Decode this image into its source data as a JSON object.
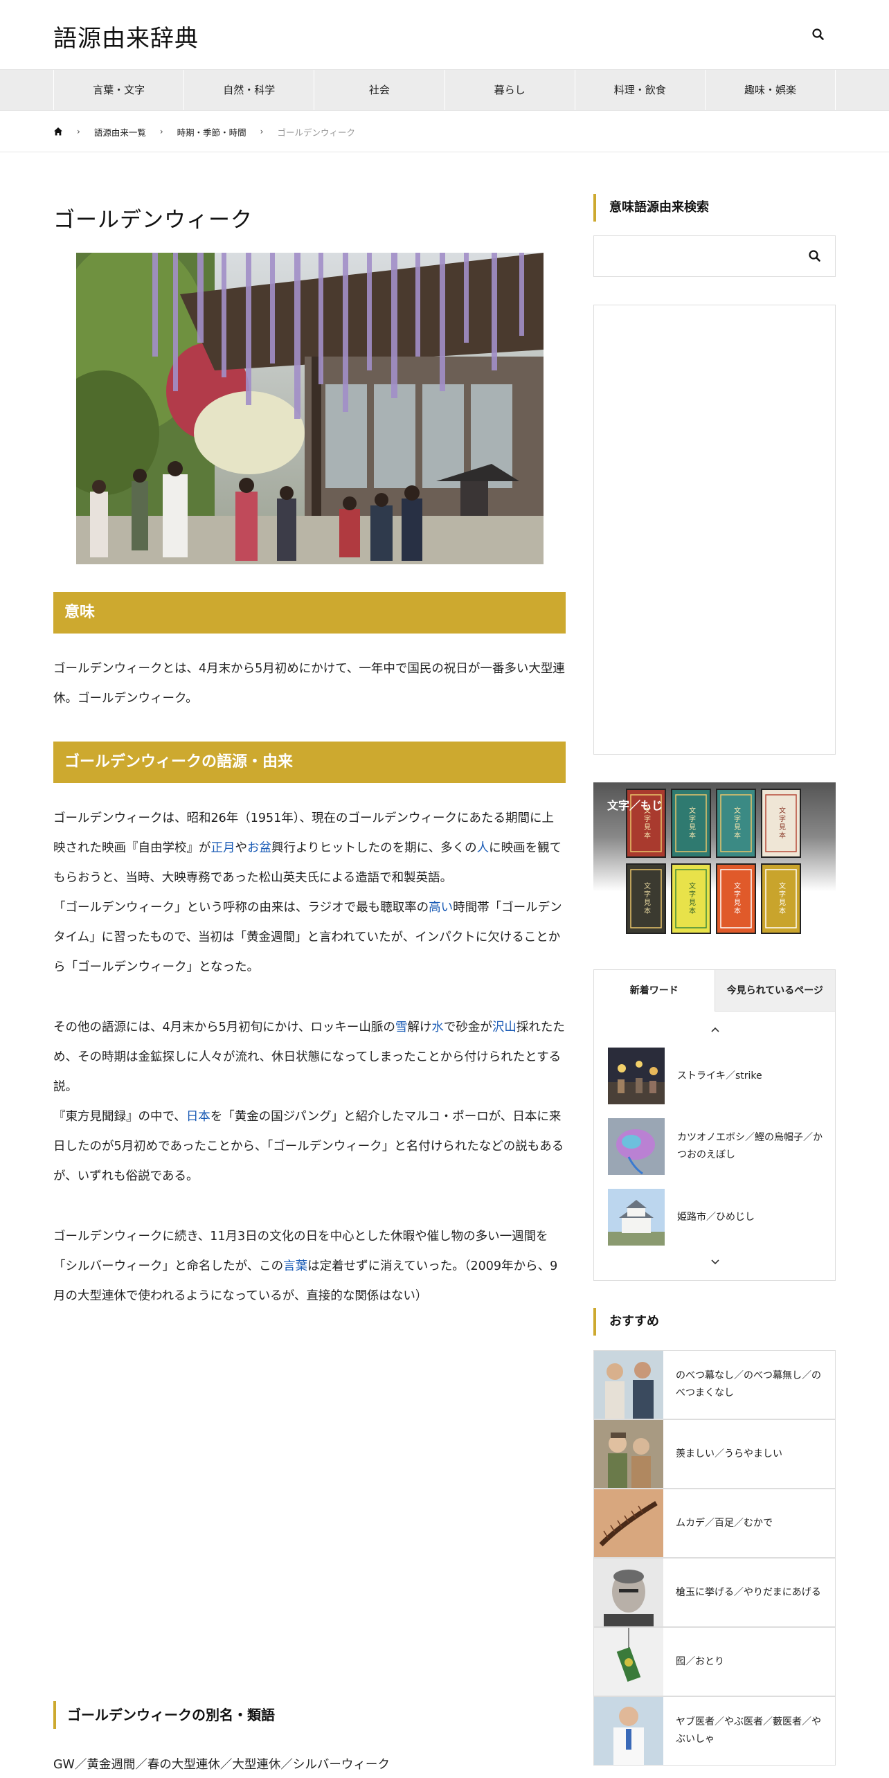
{
  "site": {
    "title": "語源由来辞典"
  },
  "nav": [
    "言葉・文字",
    "自然・科学",
    "社会",
    "暮らし",
    "料理・飲食",
    "趣味・娯楽"
  ],
  "breadcrumb": {
    "items": [
      "語源由来一覧",
      "時期・季節・時間",
      "ゴールデンウィーク"
    ]
  },
  "article": {
    "title": "ゴールデンウィーク",
    "meaning_heading": "意味",
    "meaning_text": "ゴールデンウィークとは、4月末から5月初めにかけて、一年中で国民の祝日が一番多い大型連休。ゴールデンウィーク。",
    "origin_heading": "ゴールデンウィークの語源・由来",
    "p1": {
      "a": "ゴールデンウィークは、昭和26年（1951年）、現在のゴールデンウィークにあたる期間に上映された映画『自由学校』が",
      "l1": "正月",
      "b": "や",
      "l2": "お盆",
      "c": "興行よりヒットしたのを期に、多くの",
      "l3": "人",
      "d": "に映画を観てもらおうと、当時、大映専務であった松山英夫氏による造語で和製英語。"
    },
    "p2": {
      "a": "「ゴールデンウィーク」という呼称の由来は、ラジオで最も聴取率の",
      "l1": "高い",
      "b": "時間帯「ゴールデンタイム」に習ったもので、当初は「黄金週間」と言われていたが、インパクトに欠けることから「ゴールデンウィーク」となった。"
    },
    "p3": {
      "a": "その他の語源には、4月末から5月初旬にかけ、ロッキー山脈の",
      "l1": "雪",
      "b": "解け",
      "l2": "水",
      "c": "で砂金が",
      "l3": "沢山",
      "d": "採れたため、その時期は金鉱探しに人々が流れ、休日状態になってしまったことから付けられたとする説。"
    },
    "p4": {
      "a": "『東方見聞録』の中で、",
      "l1": "日本",
      "b": "を「黄金の国ジパング」と紹介したマルコ・ポーロが、日本に来日したのが5月初めであったことから、「ゴールデンウィーク」と名付けられたなどの説もあるが、いずれも俗説である。"
    },
    "p5": {
      "a": "ゴールデンウィークに続き、11月3日の文化の日を中心とした休暇や催し物の多い一週間を「シルバーウィーク」と命名したが、この",
      "l1": "言葉",
      "b": "は定着せずに消えていった。（2009年から、9月の大型連休で使われるようになっているが、直接的な関係はない）"
    },
    "synonyms_heading": "ゴールデンウィークの別名・類語",
    "synonyms_text": "GW／黄金週間／春の大型連休／大型連休／シルバーウィーク"
  },
  "sidebar": {
    "search_title": "意味語源由来検索",
    "search_placeholder": "",
    "banner_label": "文字／もじ",
    "banner_cards": [
      "文字見本",
      "文字見本",
      "文字見本",
      "文字見本",
      "文字見本",
      "文字見本",
      "文字見本",
      "文字見本"
    ],
    "tabs": [
      "新着ワード",
      "今見られているページ"
    ],
    "new_words": [
      "ストライキ／strike",
      "カツオノエボシ／鰹の烏帽子／かつおのえぼし",
      "姫路市／ひめじし"
    ],
    "recommended_title": "おすすめ",
    "recommended": [
      "のべつ幕なし／のべつ幕無し／のべつまくなし",
      "羨ましい／うらやましい",
      "ムカデ／百足／むかで",
      "槍玉に挙げる／やりだまにあげる",
      "囮／おとり",
      "ヤブ医者／やぶ医者／藪医者／やぶいしゃ"
    ]
  }
}
